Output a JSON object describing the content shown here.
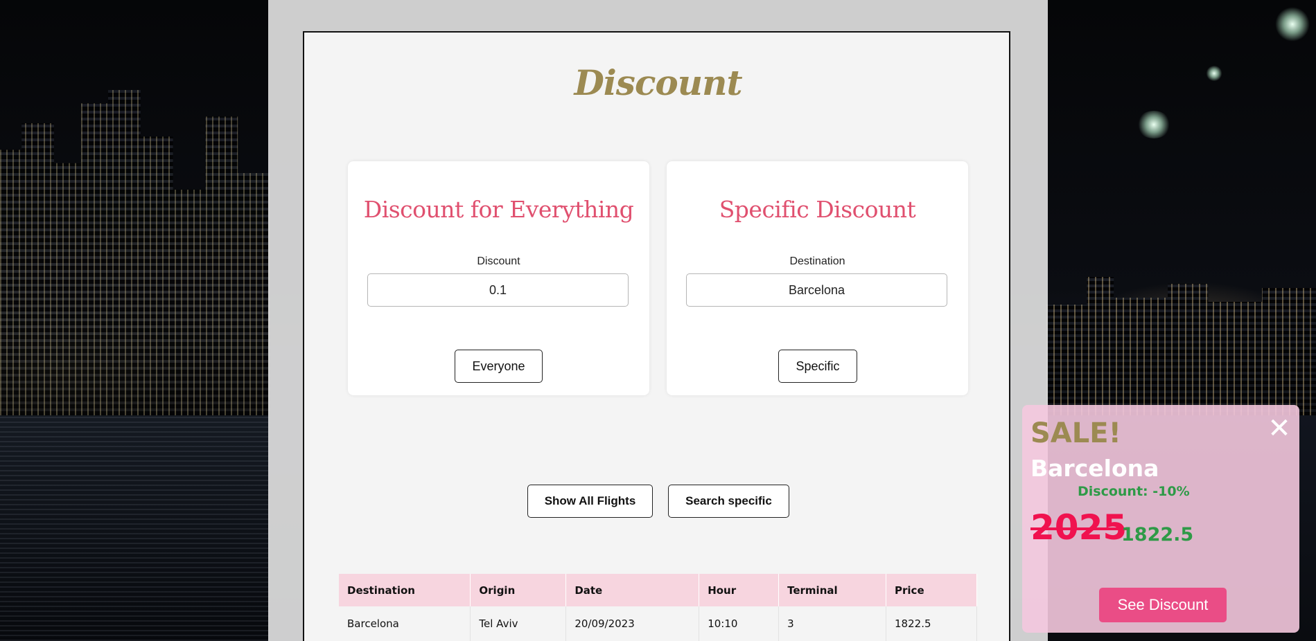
{
  "page": {
    "title": "Discount"
  },
  "everything_box": {
    "title": "Discount for Everything",
    "field_label": "Discount",
    "field_value": "0.1",
    "button_label": "Everyone"
  },
  "specific_box": {
    "title": "Specific Discount",
    "field_label": "Destination",
    "field_value": "Barcelona",
    "button_label": "Specific"
  },
  "actions": {
    "show_all_label": "Show All Flights",
    "search_label": "Search specific"
  },
  "table": {
    "headers": [
      "Destination",
      "Origin",
      "Date",
      "Hour",
      "Terminal",
      "Price"
    ],
    "rows": [
      [
        "Barcelona",
        "Tel Aviv",
        "20/09/2023",
        "10:10",
        "3",
        "1822.5"
      ]
    ]
  },
  "sale_popup": {
    "title": "SALE!",
    "destination": "Barcelona",
    "discount_text": "Discount: -10%",
    "old_price": "2025",
    "new_price": "1822.5",
    "close_glyph": "✕",
    "button_label": "See Discount"
  },
  "colors": {
    "title_gold": "#9c8a52",
    "heading_pink": "#e0506f",
    "table_header_pink": "#f7d5df",
    "sale_green": "#2e9a47",
    "sale_red": "#f0124f",
    "button_pink": "#ea4d86"
  }
}
